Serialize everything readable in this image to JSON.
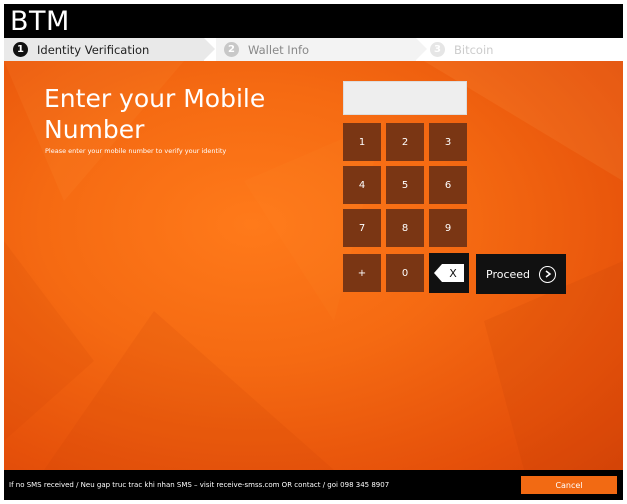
{
  "app": {
    "brand": "BTM"
  },
  "steps": [
    {
      "num": "1",
      "label": "Identity Verification"
    },
    {
      "num": "2",
      "label": "Wallet Info"
    },
    {
      "num": "3",
      "label": "Bitcoin"
    }
  ],
  "main": {
    "title_line1": "Enter your Mobile",
    "title_line2": "Number",
    "subtitle": "Please enter your mobile number to verify your identity",
    "phone_value": ""
  },
  "keypad": {
    "keys": [
      "1",
      "2",
      "3",
      "4",
      "5",
      "6",
      "7",
      "8",
      "9",
      "+",
      "0"
    ],
    "backspace_label": "X",
    "proceed_label": "Proceed"
  },
  "footer": {
    "notice": "If no SMS received / Neu gap truc trac khi nhan SMS – visit receive-smss.com OR contact / goi 098 345 8907",
    "cancel_label": "Cancel"
  },
  "colors": {
    "accent": "#f26a13",
    "key_bg": "#7a3614",
    "background": "#f56a12"
  }
}
